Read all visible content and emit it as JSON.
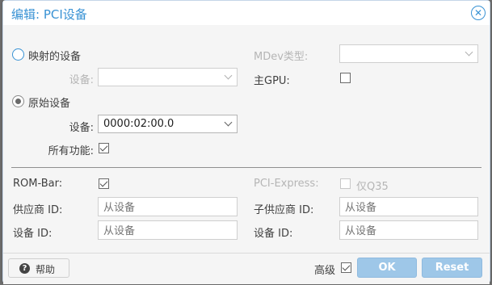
{
  "dialog": {
    "title": "编辑: PCI设备",
    "close_icon": "close-icon"
  },
  "mapped": {
    "radio_label": "映射的设备",
    "device_label": "设备:",
    "device_value": ""
  },
  "mdev": {
    "label": "MDev类型:",
    "value": ""
  },
  "primary_gpu": {
    "label": "主GPU:",
    "checked": false
  },
  "raw": {
    "radio_label": "原始设备",
    "device_label": "设备:",
    "device_value": "0000:02:00.0",
    "all_functions_label": "所有功能:",
    "all_functions_checked": true
  },
  "advanced": {
    "rombar_label": "ROM-Bar:",
    "rombar_checked": true,
    "pcie_label": "PCI-Express:",
    "q35_label": "仅Q35",
    "vendor_label": "供应商 ID:",
    "vendor_placeholder": "从设备",
    "subvendor_label": "子供应商 ID:",
    "subvendor_placeholder": "从设备",
    "device_id_label": "设备 ID:",
    "device_id_placeholder": "从设备",
    "subdevice_id_label": "设备 ID:",
    "subdevice_id_placeholder": "从设备"
  },
  "footer": {
    "help_label": "帮助",
    "advanced_label": "高级",
    "advanced_checked": true,
    "ok_label": "OK",
    "reset_label": "Reset"
  },
  "colors": {
    "accent": "#3892d4",
    "button_disabled": "#9ec7e8"
  }
}
